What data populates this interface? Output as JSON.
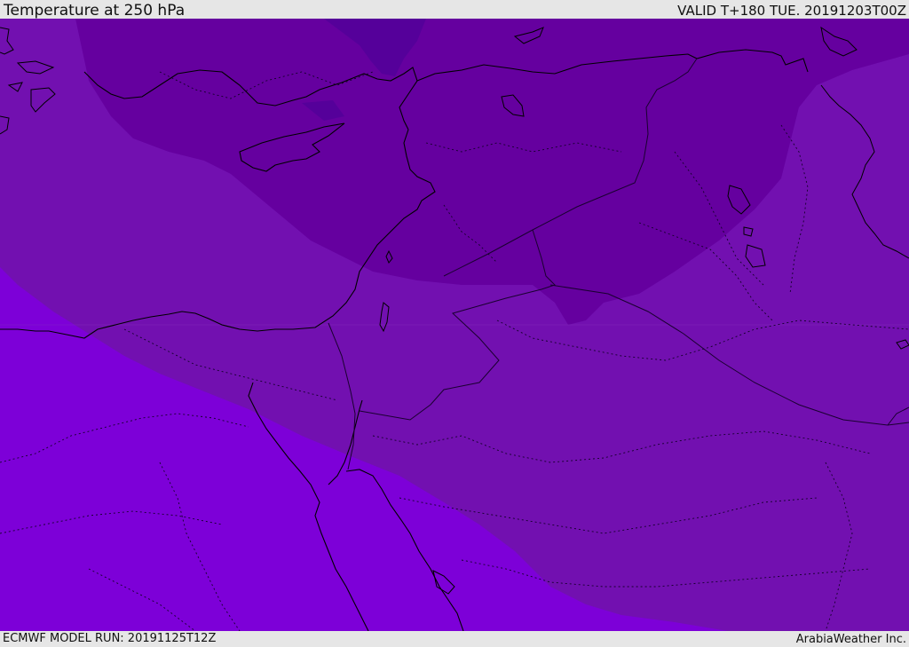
{
  "header": {
    "title": "Temperature at 250 hPa",
    "valid": "VALID T+180 TUE. 20191203T00Z"
  },
  "footer": {
    "model_run": "ECMWF MODEL RUN: 20191125T12Z",
    "credit": "ArabiaWeather Inc."
  },
  "colors": {
    "bar_background": "#e6e6e6",
    "band_coldest": "#55009a",
    "band_cold": "#65009f",
    "band_mid": "#7210b0",
    "band_warm": "#7d00d8",
    "coastline": "#000000",
    "border": "#1a0030"
  }
}
